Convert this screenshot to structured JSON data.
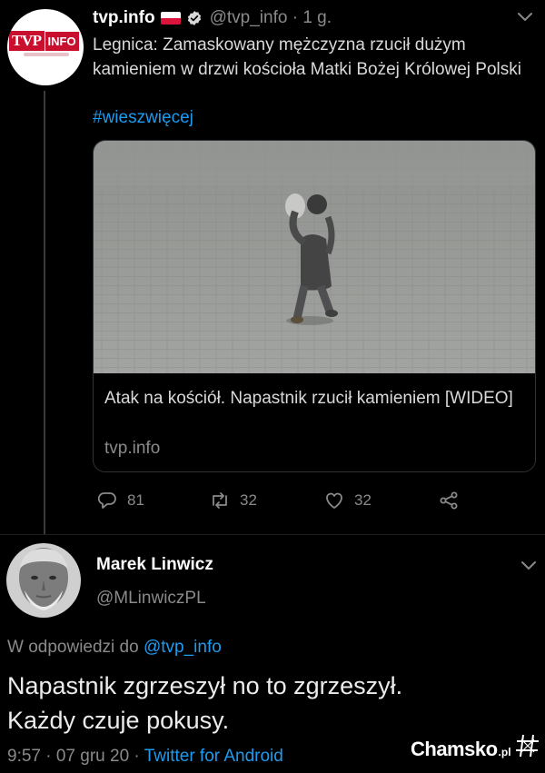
{
  "tweet": {
    "author_name": "tvp.info",
    "author_handle": "@tvp_info",
    "time": "· 1 g.",
    "avatar_logo": {
      "main": "TVP",
      "suffix": "INFO"
    },
    "text": "Legnica: Zamaskowany mężczyzna rzucił dużym kamieniem w drzwi kościoła Matki Bożej Królowej Polski",
    "hashtag": "#wieszwięcej",
    "card": {
      "title": "Atak na kościół. Napastnik rzucił kamieniem [WIDEO]",
      "domain": "tvp.info"
    },
    "actions": {
      "replies": "81",
      "retweets": "32",
      "likes": "32"
    }
  },
  "reply": {
    "author_name": "Marek Linwicz",
    "author_handle": "@MLinwiczPL",
    "reply_prefix": "W odpowiedzi do",
    "reply_to": "@tvp_info",
    "text_line1": "Napastnik zgrzeszył no to zgrzeszył.",
    "text_line2": "Każdy czuje pokusy.",
    "timestamp": "9:57 · 07 gru 20 · ",
    "client": "Twitter for Android"
  },
  "watermark": {
    "main": "Chamsko",
    "tld": ".pl"
  },
  "colors": {
    "background": "#000000",
    "link": "#1d9bf0",
    "muted": "#8a8a8a",
    "brand_red": "#c8102e"
  },
  "icons": [
    "verified-badge-icon",
    "chevron-down-icon",
    "reply-icon",
    "retweet-icon",
    "like-icon",
    "share-icon",
    "chamsko-logo-icon"
  ]
}
